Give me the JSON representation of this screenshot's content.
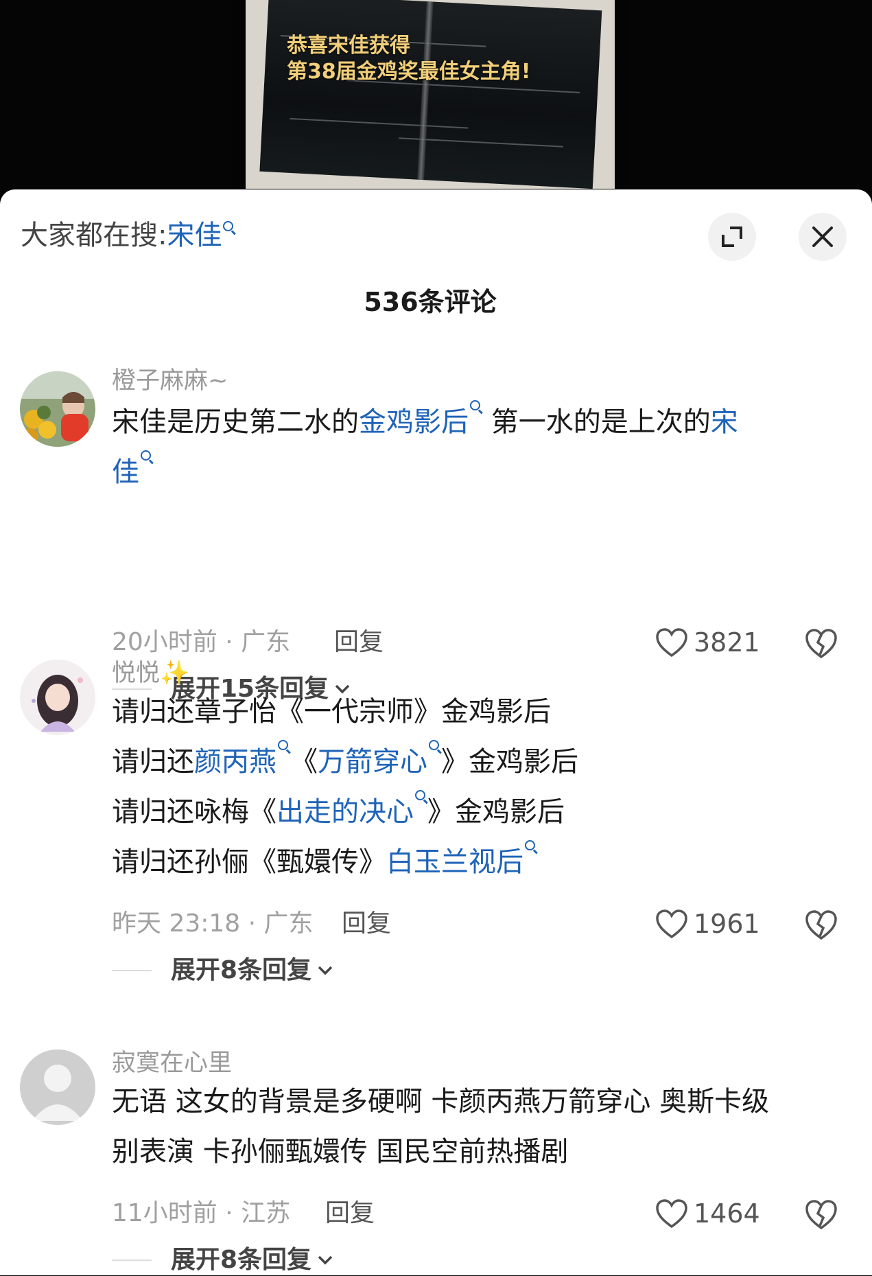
{
  "video": {
    "poster_line1": "恭喜宋佳获得",
    "poster_line2": "第38届金鸡奖最佳女主角!"
  },
  "header": {
    "search_prefix": "大家都在搜:",
    "search_term": "宋佳",
    "expand_icon": "expand-icon",
    "close_icon": "close-icon",
    "comment_count_title": "536条评论"
  },
  "colors": {
    "link": "#1e63b8",
    "meta": "#a0a0a0",
    "poster_text": "#f2cf7a"
  },
  "comments": [
    {
      "username": "橙子麻麻~",
      "segments_line1": [
        "宋佳是历史第二水的",
        "金鸡影后",
        " 第一水的是上次的",
        "宋"
      ],
      "segments_line2": [
        "佳"
      ],
      "time_location": "20小时前 · 广东",
      "reply_label": "回复",
      "likes": "3821",
      "expand_label": "展开15条回复"
    },
    {
      "username": "悦悦",
      "username_emoji": "✨",
      "lines": [
        [
          "请归还章子怡《一代宗师》金鸡影后"
        ],
        [
          "请归还",
          "颜丙燕",
          "《",
          "万箭穿心",
          "》金鸡影后"
        ],
        [
          "请归还咏梅《",
          "出走的决心",
          "》金鸡影后"
        ],
        [
          "请归还孙俪《甄嬛传》",
          "白玉兰视后"
        ]
      ],
      "time_location": "昨天 23:18 · 广东",
      "reply_label": "回复",
      "likes": "1961",
      "expand_label": "展开8条回复"
    },
    {
      "username": "寂寞在心里",
      "lines": [
        [
          "无语 这女的背景是多硬啊 卡颜丙燕万箭穿心 奥斯卡级"
        ],
        [
          "别表演 卡孙俪甄嬛传 国民空前热播剧"
        ]
      ],
      "time_location": "11小时前 · 江苏",
      "reply_label": "回复",
      "likes": "1464",
      "expand_label": "展开8条回复"
    }
  ]
}
